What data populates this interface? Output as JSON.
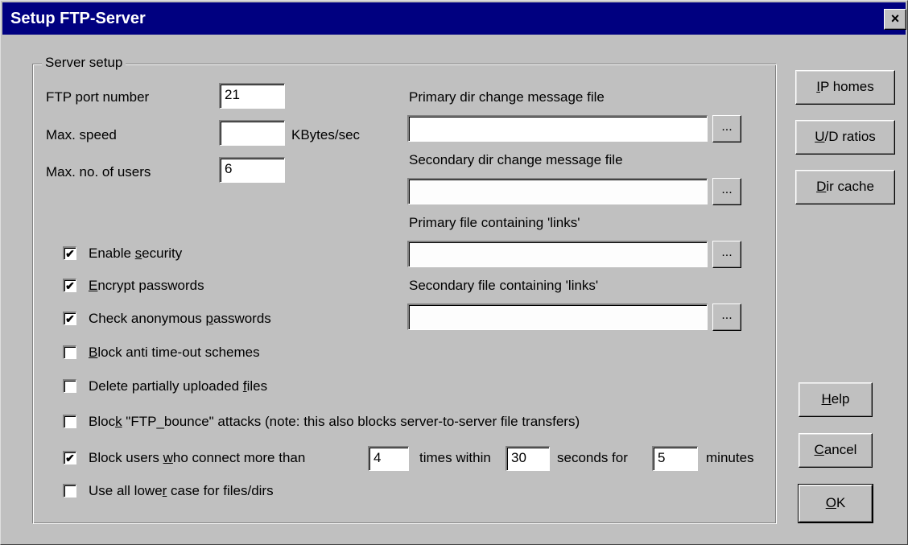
{
  "window": {
    "title": "Setup FTP-Server",
    "close_glyph": "×"
  },
  "group": {
    "legend": "Server setup"
  },
  "fields": {
    "port": {
      "label": "FTP port number",
      "value": "21"
    },
    "speed": {
      "label": "Max. speed",
      "value": "",
      "unit": "KBytes/sec"
    },
    "users": {
      "label": "Max. no. of users",
      "value": "6"
    }
  },
  "files": {
    "primary_dir": {
      "label": "Primary dir change message file",
      "value": ""
    },
    "secondary_dir": {
      "label": "Secondary dir change message file",
      "value": ""
    },
    "primary_links": {
      "label": "Primary file containing 'links'",
      "value": ""
    },
    "secondary_links": {
      "label": "Secondary file containing 'links'",
      "value": ""
    },
    "browse_label": "..."
  },
  "checkboxes": [
    {
      "pre": "Enable ",
      "u": "s",
      "post": "ecurity",
      "checked": true
    },
    {
      "pre": "",
      "u": "E",
      "post": "ncrypt passwords",
      "checked": true
    },
    {
      "pre": "Check anonymous ",
      "u": "p",
      "post": "asswords",
      "checked": true
    },
    {
      "pre": "",
      "u": "B",
      "post": "lock anti time-out schemes",
      "checked": false
    },
    {
      "pre": "Delete partially uploaded ",
      "u": "f",
      "post": "iles",
      "checked": false
    },
    {
      "pre": "Bloc",
      "u": "k",
      "post": " \"FTP_bounce\" attacks (note: this also blocks server-to-server file transfers)",
      "checked": false
    },
    {
      "pre": "Block users ",
      "u": "w",
      "post": "ho connect more than",
      "checked": true
    },
    {
      "pre": "Use all lowe",
      "u": "r",
      "post": " case for files/dirs",
      "checked": false
    }
  ],
  "block_users": {
    "times_value": "4",
    "times_label": "times within",
    "seconds_value": "30",
    "seconds_label": "seconds for",
    "minutes_value": "5",
    "minutes_label": "minutes"
  },
  "side_buttons": {
    "ip_homes": {
      "u": "I",
      "post": "P homes"
    },
    "ud_ratios": {
      "u": "U",
      "post": "/D ratios"
    },
    "dir_cache": {
      "u": "D",
      "post": "ir cache"
    },
    "help": {
      "u": "H",
      "post": "elp"
    },
    "cancel": {
      "u": "C",
      "post": "ancel"
    },
    "ok": {
      "u": "O",
      "post": "K"
    }
  }
}
